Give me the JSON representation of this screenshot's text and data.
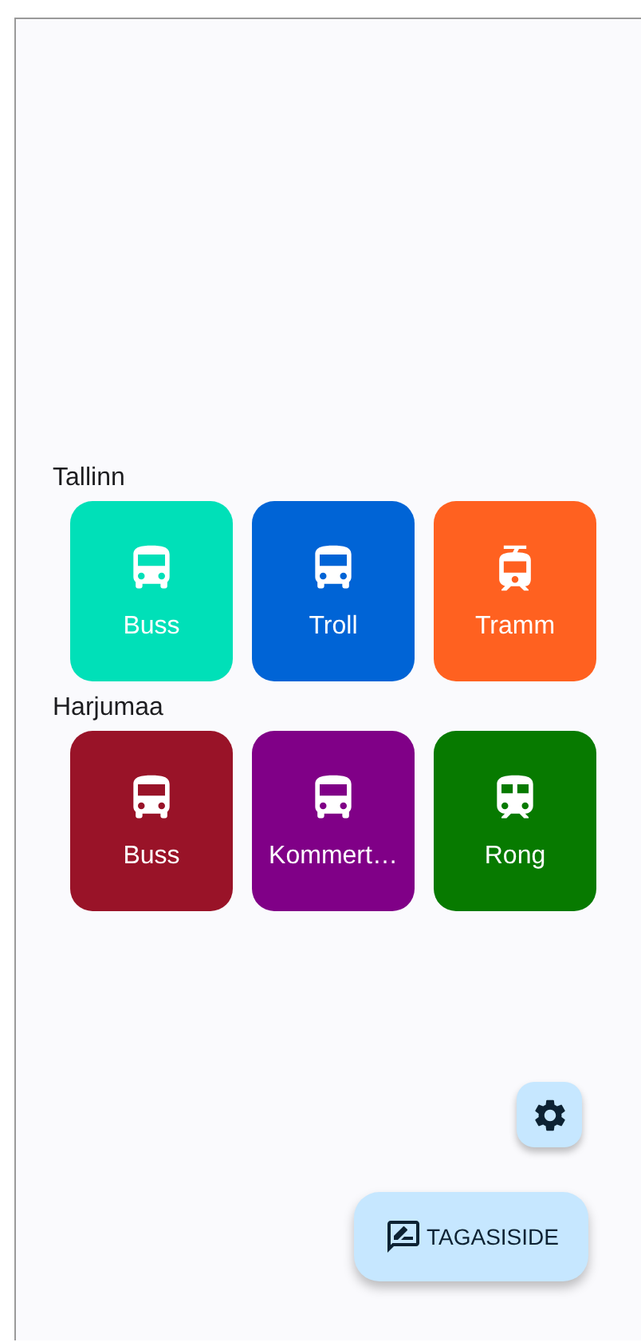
{
  "regions": [
    {
      "name": "Tallinn",
      "tiles": [
        {
          "label": "Buss",
          "kind": "bus",
          "color": "#00e0b8"
        },
        {
          "label": "Troll",
          "kind": "bus",
          "color": "#0064d6"
        },
        {
          "label": "Tramm",
          "kind": "tram",
          "color": "#ff6120"
        }
      ]
    },
    {
      "name": "Harjumaa",
      "tiles": [
        {
          "label": "Buss",
          "kind": "bus",
          "color": "#991328"
        },
        {
          "label": "Kommert…",
          "kind": "bus",
          "color": "#800087"
        },
        {
          "label": "Rong",
          "kind": "train",
          "color": "#077a00"
        }
      ]
    }
  ],
  "feedback_button": {
    "label": "TAGASISIDE"
  }
}
